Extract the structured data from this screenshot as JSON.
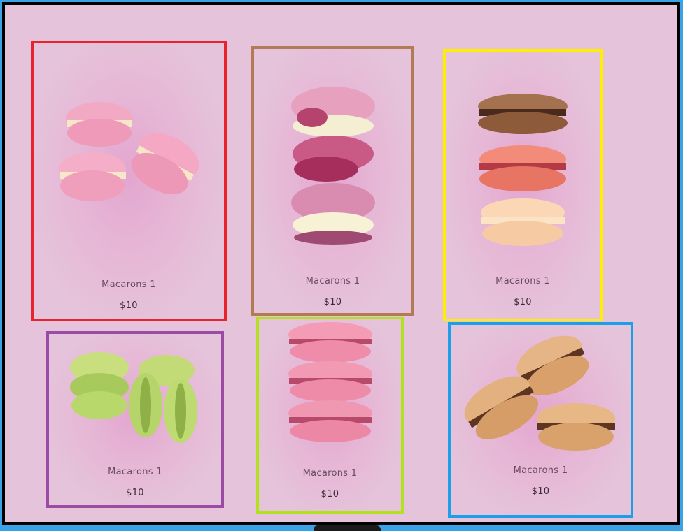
{
  "products": [
    {
      "name": "Macarons 1",
      "price": "$10",
      "image": "pink-macarons-cluster",
      "border": "#e8232b"
    },
    {
      "name": "Macarons 1",
      "price": "$10",
      "image": "bitten-raspberry-macaron-stack",
      "border": "#b27a55"
    },
    {
      "name": "Macarons 1",
      "price": "$10",
      "image": "chocolate-strawberry-vanilla-macaron-stack",
      "border": "#ffee00"
    },
    {
      "name": "Macarons 1",
      "price": "$10",
      "image": "pistachio-macarons-cluster",
      "border": "#9b4aa5"
    },
    {
      "name": "Macarons 1",
      "price": "$10",
      "image": "pink-macaron-stack",
      "border": "#b3e21c"
    },
    {
      "name": "Macarons 1",
      "price": "$10",
      "image": "caramel-macarons-cluster",
      "border": "#1b9fe8"
    }
  ]
}
